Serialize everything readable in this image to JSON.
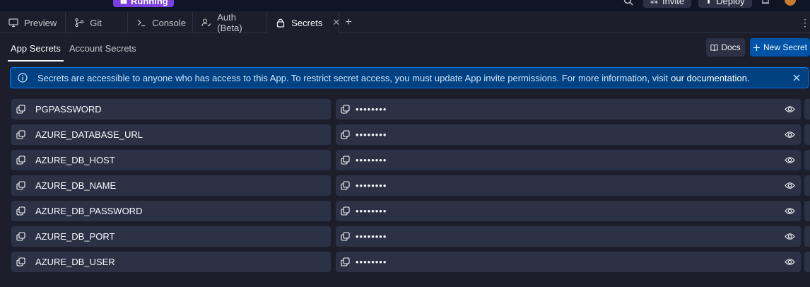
{
  "topbar": {
    "run_label": "Running",
    "invite_label": "Invite",
    "deploy_label": "Deploy"
  },
  "tabs": [
    {
      "label": "Preview",
      "icon": "monitor-icon"
    },
    {
      "label": "Git",
      "icon": "git-icon"
    },
    {
      "label": "Console",
      "icon": "terminal-icon"
    },
    {
      "label": "Auth (Beta)",
      "icon": "user-check-icon"
    },
    {
      "label": "Secrets",
      "icon": "lock-icon",
      "active": true
    }
  ],
  "subtabs": {
    "app": "App Secrets",
    "account": "Account Secrets"
  },
  "actions": {
    "docs_label": "Docs",
    "new_secret_label": "New Secret"
  },
  "banner": {
    "text": "Secrets are accessible to anyone who has access to this App. To restrict secret access, you must update App invite permissions. For more information, visit",
    "link_text": "our documentation."
  },
  "secrets": [
    {
      "key": "PGPASSWORD",
      "value": "••••••••"
    },
    {
      "key": "AZURE_DATABASE_URL",
      "value": "••••••••"
    },
    {
      "key": "AZURE_DB_HOST",
      "value": "••••••••"
    },
    {
      "key": "AZURE_DB_NAME",
      "value": "••••••••"
    },
    {
      "key": "AZURE_DB_PASSWORD",
      "value": "••••••••"
    },
    {
      "key": "AZURE_DB_PORT",
      "value": "••••••••"
    },
    {
      "key": "AZURE_DB_USER",
      "value": "••••••••"
    }
  ],
  "colors": {
    "background": "#1c1f2b",
    "surface": "#2b3245",
    "primary": "#0053a6",
    "banner_bg": "#004182",
    "banner_border": "#0079f2",
    "running": "#7b3fe4"
  }
}
